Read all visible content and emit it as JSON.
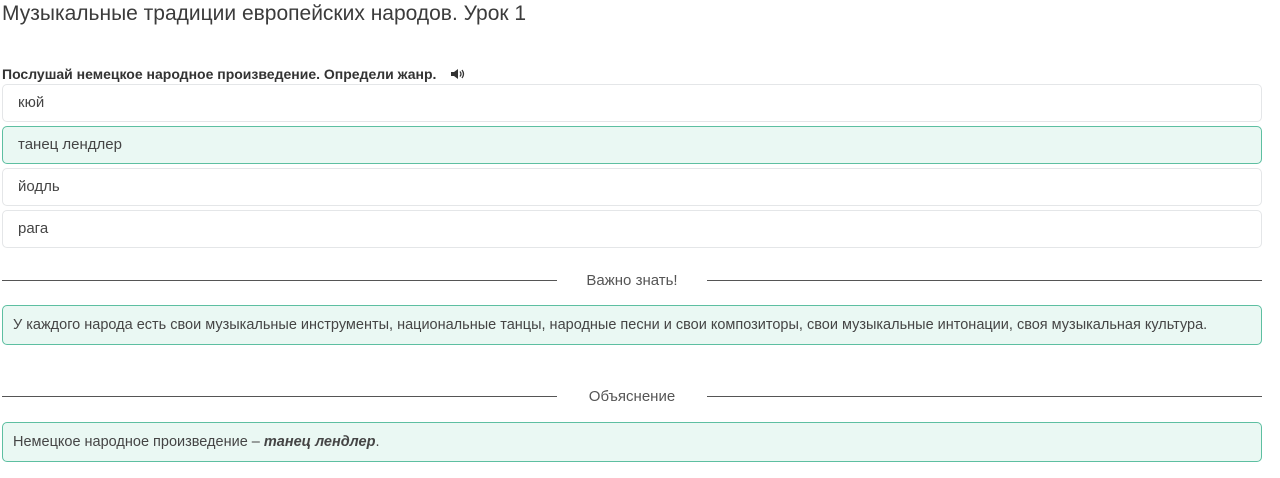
{
  "page": {
    "title": "Музыкальные традиции европейских народов. Урок 1"
  },
  "question": {
    "text": "Послушай немецкое народное произведение. Определи жанр.",
    "audio_icon": "speaker-icon"
  },
  "options": [
    {
      "label": "кюй",
      "selected": false
    },
    {
      "label": "танец лендлер",
      "selected": true
    },
    {
      "label": "йодль",
      "selected": false
    },
    {
      "label": "рага",
      "selected": false
    }
  ],
  "important": {
    "heading": "Важно знать!",
    "text": "У каждого народа есть свои музыкальные инструменты, национальные танцы, народные песни и свои композиторы, свои музыкальные интонации, своя музыкальная культура."
  },
  "explanation": {
    "heading": "Объяснение",
    "prefix": "Немецкое народное произведение – ",
    "answer": "танец лендлер",
    "suffix": "."
  },
  "colors": {
    "selected_bg": "#eaf8f3",
    "selected_border": "#5dbfa1"
  }
}
